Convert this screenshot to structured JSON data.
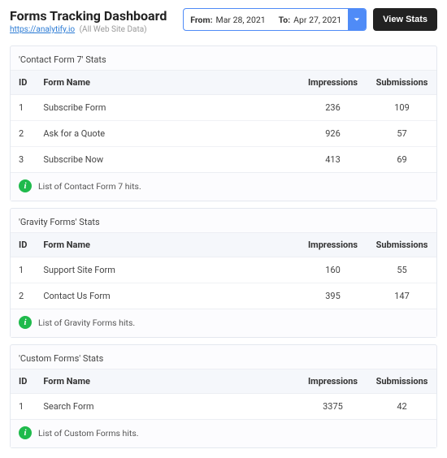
{
  "header": {
    "title": "Forms Tracking Dashboard",
    "site_url": "https://analytify.io",
    "site_note": "(All Web Site Data)",
    "date_from_label": "From:",
    "date_from_value": "Mar 28, 2021",
    "date_to_label": "To:",
    "date_to_value": "Apr 27, 2021",
    "view_stats_label": "View Stats"
  },
  "columns": {
    "id": "ID",
    "name": "Form Name",
    "impressions": "Impressions",
    "submissions": "Submissions"
  },
  "blocks": [
    {
      "title": "'Contact Form 7' Stats",
      "footer": "List of Contact Form 7 hits.",
      "rows": [
        {
          "id": "1",
          "name": "Subscribe Form",
          "impressions": "236",
          "submissions": "109"
        },
        {
          "id": "2",
          "name": "Ask for a Quote",
          "impressions": "926",
          "submissions": "57"
        },
        {
          "id": "3",
          "name": "Subscribe Now",
          "impressions": "413",
          "submissions": "69"
        }
      ]
    },
    {
      "title": "'Gravity Forms' Stats",
      "footer": "List of Gravity Forms hits.",
      "rows": [
        {
          "id": "1",
          "name": "Support Site Form",
          "impressions": "160",
          "submissions": "55"
        },
        {
          "id": "2",
          "name": "Contact Us Form",
          "impressions": "395",
          "submissions": "147"
        }
      ]
    },
    {
      "title": "'Custom Forms' Stats",
      "footer": "List of Custom Forms hits.",
      "rows": [
        {
          "id": "1",
          "name": "Search Form",
          "impressions": "3375",
          "submissions": "42"
        }
      ]
    }
  ]
}
